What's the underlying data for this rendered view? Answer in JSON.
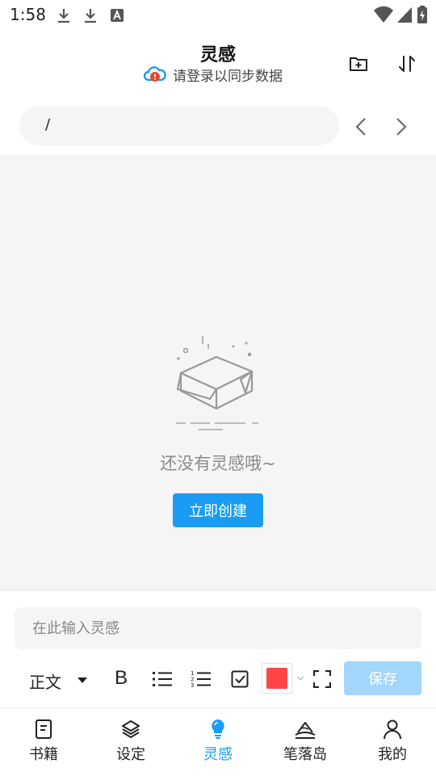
{
  "status_bar": {
    "time": "1:58"
  },
  "header": {
    "title": "灵感",
    "sync_text": "请登录以同步数据"
  },
  "path_bar": {
    "path": "/"
  },
  "empty_state": {
    "message": "还没有灵感哦~",
    "button_label": "立即创建"
  },
  "editor": {
    "placeholder": "在此输入灵感",
    "format_label": "正文",
    "bold_label": "B",
    "text_color": "#ff4545",
    "save_label": "保存"
  },
  "nav": {
    "items": [
      {
        "label": "书籍"
      },
      {
        "label": "设定"
      },
      {
        "label": "灵感"
      },
      {
        "label": "笔落岛"
      },
      {
        "label": "我的"
      }
    ],
    "active_index": 2
  },
  "colors": {
    "accent": "#1a9cf4",
    "save_disabled": "#a3d6fb",
    "background": "#f5f5f5"
  }
}
